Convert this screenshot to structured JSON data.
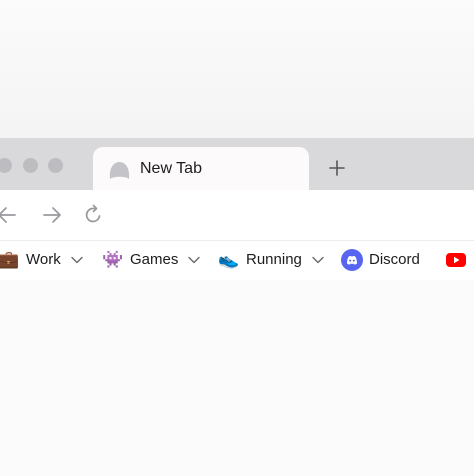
{
  "tabs": [
    {
      "title": "New Tab",
      "favicon": "ghost-icon"
    }
  ],
  "toolbar": {
    "new_tab_icon": "plus-icon",
    "back_icon": "arrow-left-icon",
    "forward_icon": "arrow-right-icon",
    "reload_icon": "reload-icon"
  },
  "bookmarks": [
    {
      "label": "Work",
      "emoji": "💼",
      "icon": "briefcase-icon",
      "folder": true
    },
    {
      "label": "Games",
      "emoji": "👾",
      "icon": "alien-monster-icon",
      "folder": true
    },
    {
      "label": "Running",
      "emoji": "👟",
      "icon": "running-shoe-icon",
      "folder": true
    },
    {
      "label": "Discord",
      "icon": "discord-icon",
      "folder": false
    },
    {
      "label": "",
      "icon": "youtube-icon",
      "folder": false
    }
  ],
  "colors": {
    "tab_strip": "#d9d9dc",
    "active_tab": "#fdfafb",
    "discord": "#5865f2",
    "youtube": "#ff0000"
  }
}
